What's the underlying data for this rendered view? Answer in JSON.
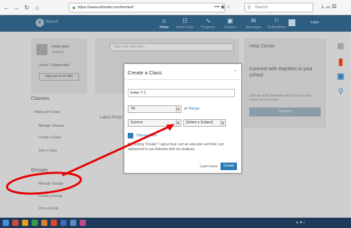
{
  "browser": {
    "url": "https://www.edmodo.com/home#/",
    "url_icons": "••• ◉ ☆",
    "search_placeholder": "Search"
  },
  "app_nav": {
    "search_placeholder": "Search",
    "items": [
      {
        "label": "Home",
        "icon": "⌂"
      },
      {
        "label": "What's Due",
        "icon": "☷"
      },
      {
        "label": "Progress",
        "icon": "∿"
      },
      {
        "label": "Classes",
        "icon": "▣"
      },
      {
        "label": "Messages",
        "icon": "✉"
      },
      {
        "label": "Notifications",
        "icon": "⚐"
      }
    ],
    "user_label": "indah"
  },
  "profile": {
    "name": "indah putri",
    "role": "Teacher",
    "school": "Sman 1 Bakeendah",
    "improve_button": "Improve ke Profile"
  },
  "post": {
    "placeholder": "Type your note here...",
    "latest_label": "Latest Posts"
  },
  "classes": {
    "title": "Classes",
    "items": [
      "indah putri Class",
      "Manage Classes",
      "Create a Class",
      "Join a Class"
    ]
  },
  "groups": {
    "title": "Groups",
    "items": [
      "Manage Groups",
      "Create a Group",
      "Join a Group"
    ]
  },
  "help": {
    "title": "Help Center",
    "subtitle": "Connect with teachers in your school",
    "small": "Edmodo works best when all teachers in your school are connected",
    "button": "Connect"
  },
  "modal": {
    "title": "Create a Class",
    "close": "×",
    "class_name": "kelas 7-1",
    "grade": "7th",
    "range_prefix": "or",
    "range_link": "Range",
    "subject_area": "Science",
    "subject": "[Select a Subject]",
    "change_color": "Change Color",
    "terms": "By clicking \"Create\" I agree that I am an educator and that I am authorized to use Edmodo with my students.",
    "learn_more": "Learn more",
    "create": "Create"
  },
  "colors": {
    "accent": "#2b7bb9",
    "nav": "#2d5d7f",
    "annotation": "#e60000"
  }
}
